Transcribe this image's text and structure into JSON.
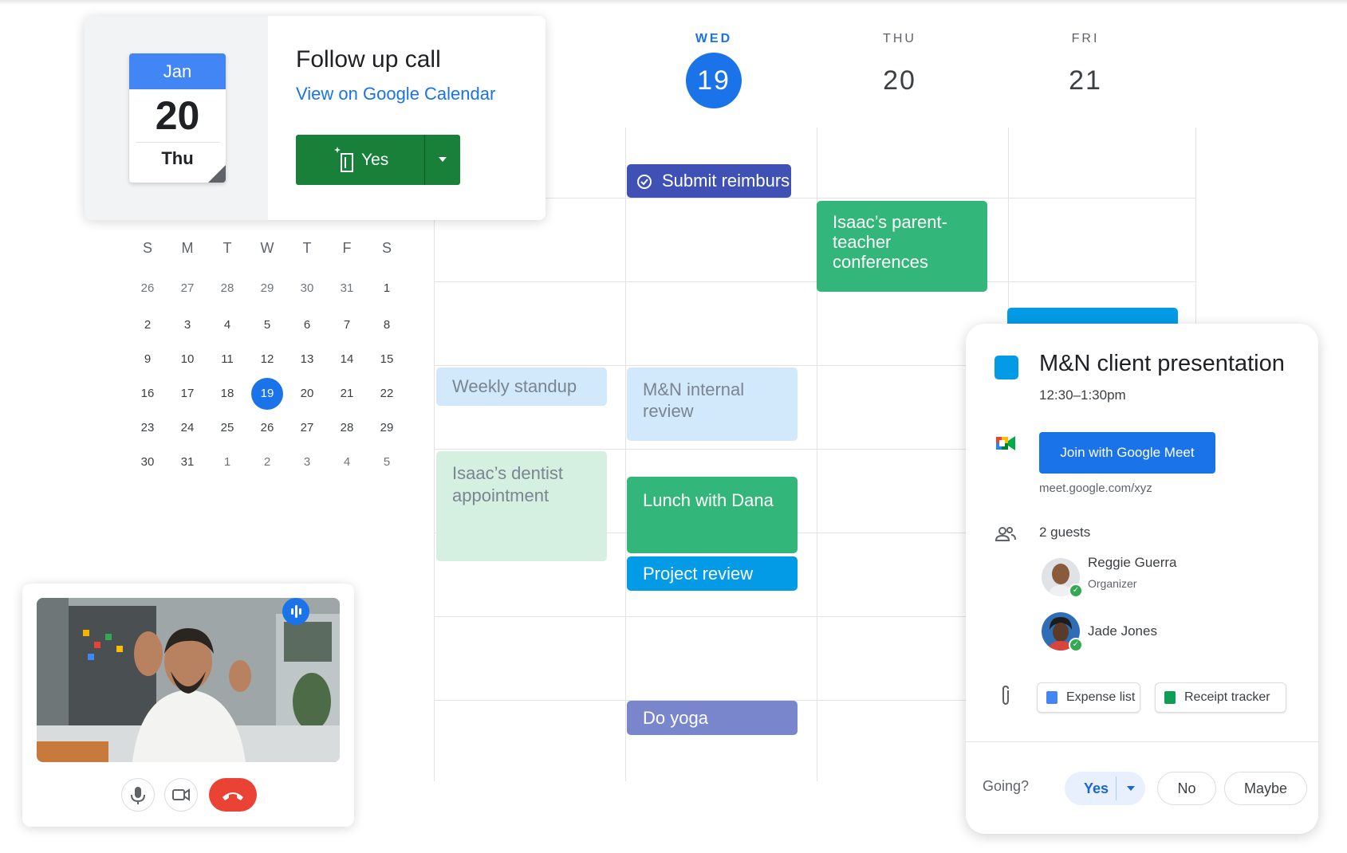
{
  "week": {
    "days": [
      {
        "name": "WED",
        "number": "19",
        "active": true
      },
      {
        "name": "THU",
        "number": "20",
        "active": false
      },
      {
        "name": "FRI",
        "number": "21",
        "active": false
      }
    ]
  },
  "events": {
    "submit": "Submit reimburs",
    "parent_teacher": "Isaac’s parent-teacher conferences",
    "weekly_standup": "Weekly standup",
    "internal_review": "M&N internal review",
    "dentist": "Isaac’s dentist appointment",
    "lunch": "Lunch with Dana",
    "project_review": "Project review",
    "yoga": "Do yoga"
  },
  "follow_up": {
    "month": "Jan",
    "day": "20",
    "weekday": "Thu",
    "title": "Follow up call",
    "link": "View on Google Calendar",
    "yes_label": "Yes"
  },
  "mini_calendar": {
    "headers": [
      "S",
      "M",
      "T",
      "W",
      "T",
      "F",
      "S"
    ],
    "weeks": [
      [
        "26",
        "27",
        "28",
        "29",
        "30",
        "31",
        "1"
      ],
      [
        "2",
        "3",
        "4",
        "5",
        "6",
        "7",
        "8"
      ],
      [
        "9",
        "10",
        "11",
        "12",
        "13",
        "14",
        "15"
      ],
      [
        "16",
        "17",
        "18",
        "19",
        "20",
        "21",
        "22"
      ],
      [
        "23",
        "24",
        "25",
        "26",
        "27",
        "28",
        "29"
      ],
      [
        "30",
        "31",
        "1",
        "2",
        "3",
        "4",
        "5"
      ]
    ],
    "today": "19"
  },
  "detail": {
    "color": "#039be5",
    "title": "M&N client presentation",
    "time": "12:30–1:30pm",
    "join_label": "Join with Google Meet",
    "meet_link": "meet.google.com/xyz",
    "guests_count": "2 guests",
    "guests": [
      {
        "name": "Reggie Guerra",
        "role": "Organizer"
      },
      {
        "name": "Jade Jones",
        "role": ""
      }
    ],
    "attachments": [
      "Expense list",
      "Receipt tracker"
    ],
    "going_label": "Going?",
    "rsvp": {
      "yes": "Yes",
      "no": "No",
      "maybe": "Maybe"
    }
  },
  "colors": {
    "accent": "#1a73e8",
    "green": "#33b679",
    "indigo": "#3f51b5",
    "cyan": "#039be5",
    "lavender": "#7986cb",
    "end_call": "#ea4335"
  },
  "icons": [
    "task-check-icon",
    "sparkle-door-icon",
    "google-meet-icon",
    "people-icon",
    "paperclip-icon",
    "docs-icon",
    "sheets-icon",
    "mic-icon",
    "camera-icon",
    "end-call-icon",
    "speaking-icon"
  ]
}
